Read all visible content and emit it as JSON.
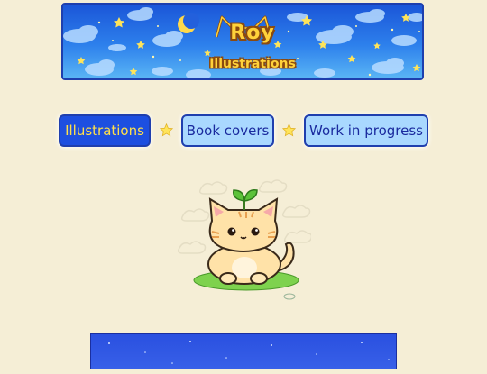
{
  "banner": {
    "logo_title": "Roy",
    "logo_subtitle": "Illustrations"
  },
  "nav": {
    "items": [
      {
        "label": "Illustrations",
        "active": true
      },
      {
        "label": "Book covers",
        "active": false
      },
      {
        "label": "Work in progress",
        "active": false
      }
    ]
  },
  "colors": {
    "page_background": "#f5eed6",
    "button_active": "#1d4fe0",
    "button_inactive": "#a9d8ff",
    "button_text": "#1a2a9e",
    "active_text": "#ffe04a",
    "banner_sky": "#2d80ec",
    "logo_yellow": "#ffd23a"
  },
  "icons": {
    "banner_moon": "crescent-moon-icon",
    "separator": "star-icon",
    "hero": "cat-with-leaf-illustration"
  }
}
